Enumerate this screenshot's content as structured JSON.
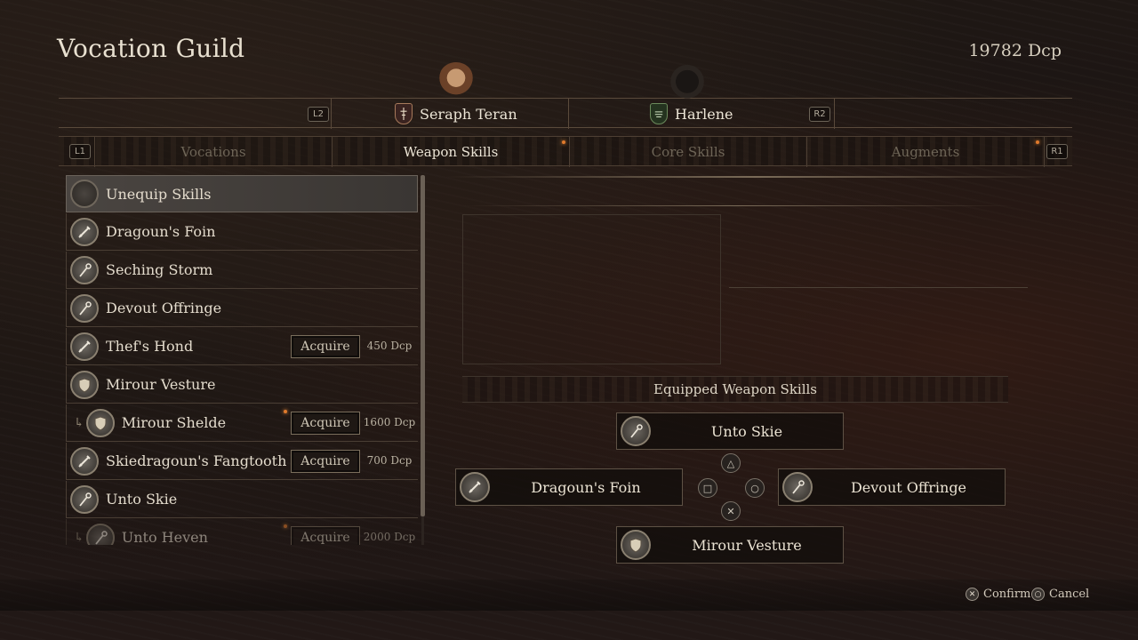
{
  "header": {
    "title": "Vocation Guild",
    "currency": "19782 Dcp"
  },
  "party": {
    "prev_hint": "L2",
    "next_hint": "R2",
    "members": [
      {
        "name": "Seraph Teran",
        "crest_color": "#b23a2e"
      },
      {
        "name": "Harlene",
        "crest_color": "#3d6b3a"
      }
    ]
  },
  "categories": {
    "prev_hint": "L1",
    "next_hint": "R1",
    "tabs": [
      {
        "label": "Vocations",
        "active": false
      },
      {
        "label": "Weapon Skills",
        "active": true,
        "notification": true
      },
      {
        "label": "Core Skills",
        "active": false
      },
      {
        "label": "Augments",
        "active": false,
        "notification": true
      }
    ]
  },
  "skills": [
    {
      "label": "Unequip Skills",
      "icon": "empty-icon",
      "selected": true
    },
    {
      "label": "Dragoun's Foin",
      "icon": "sword-icon"
    },
    {
      "label": "Seching Storm",
      "icon": "staff-icon"
    },
    {
      "label": "Devout Offringe",
      "icon": "staff-icon"
    },
    {
      "label": "Thef's Hond",
      "icon": "sword-icon",
      "acquire": "Acquire",
      "cost": "450  Dcp"
    },
    {
      "label": "Mirour Vesture",
      "icon": "shield-icon"
    },
    {
      "label": "Mirour Shelde",
      "icon": "shield-icon",
      "sub": true,
      "new": true,
      "acquire": "Acquire",
      "cost": "1600  Dcp"
    },
    {
      "label": "Skiedragoun's Fangtooth",
      "icon": "sword-icon",
      "acquire": "Acquire",
      "cost": "700  Dcp"
    },
    {
      "label": "Unto Skie",
      "icon": "staff-icon"
    },
    {
      "label": "Unto Heven",
      "icon": "staff-icon",
      "sub": true,
      "new": true,
      "acquire": "Acquire",
      "cost": "2000  Dcp",
      "faded": true
    }
  ],
  "equipped": {
    "title": "Equipped Weapon Skills",
    "top": {
      "label": "Unto Skie",
      "icon": "staff-icon",
      "button": "triangle"
    },
    "left": {
      "label": "Dragoun's Foin",
      "icon": "sword-icon",
      "button": "square"
    },
    "right": {
      "label": "Devout Offringe",
      "icon": "staff-icon",
      "button": "circle"
    },
    "bottom": {
      "label": "Mirour Vesture",
      "icon": "shield-icon",
      "button": "cross"
    }
  },
  "footer": {
    "confirm": "Confirm",
    "cancel": "Cancel"
  }
}
